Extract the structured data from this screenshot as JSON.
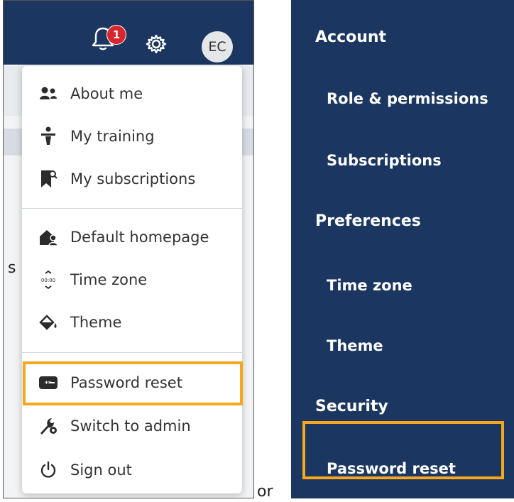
{
  "header": {
    "notification_count": "1",
    "avatar_initials": "EC"
  },
  "page": {
    "fragment_text": "s"
  },
  "user_menu": {
    "groups": [
      [
        "About me",
        "My training",
        "My subscriptions"
      ],
      [
        "Default homepage",
        "Time zone",
        "Theme"
      ],
      [
        "Password reset",
        "Switch to admin",
        "Sign out"
      ]
    ],
    "items": [
      {
        "label": "About me",
        "icon": "users-icon"
      },
      {
        "label": "My training",
        "icon": "training-icon"
      },
      {
        "label": "My subscriptions",
        "icon": "bookmark-subscription-icon"
      },
      {
        "label": "Default homepage",
        "icon": "home-person-icon"
      },
      {
        "label": "Time zone",
        "icon": "time-zone-icon"
      },
      {
        "label": "Theme",
        "icon": "paint-bucket-icon"
      },
      {
        "label": "Password reset",
        "icon": "password-icon"
      },
      {
        "label": "Switch to admin",
        "icon": "wrench-gear-icon"
      },
      {
        "label": "Sign out",
        "icon": "power-icon"
      }
    ],
    "highlighted": "Password reset"
  },
  "separator_text": "or",
  "settings_nav": {
    "sections": [
      {
        "title": "Account",
        "items": [
          "Role & permissions",
          "Subscriptions"
        ]
      },
      {
        "title": "Preferences",
        "items": [
          "Time zone",
          "Theme"
        ]
      },
      {
        "title": "Security",
        "items": [
          "Password reset"
        ]
      }
    ],
    "highlighted": "Password reset"
  },
  "colors": {
    "nav_background": "#1a3661",
    "highlight": "#f7a71b",
    "badge": "#d7262e",
    "menu_text": "#333333"
  }
}
